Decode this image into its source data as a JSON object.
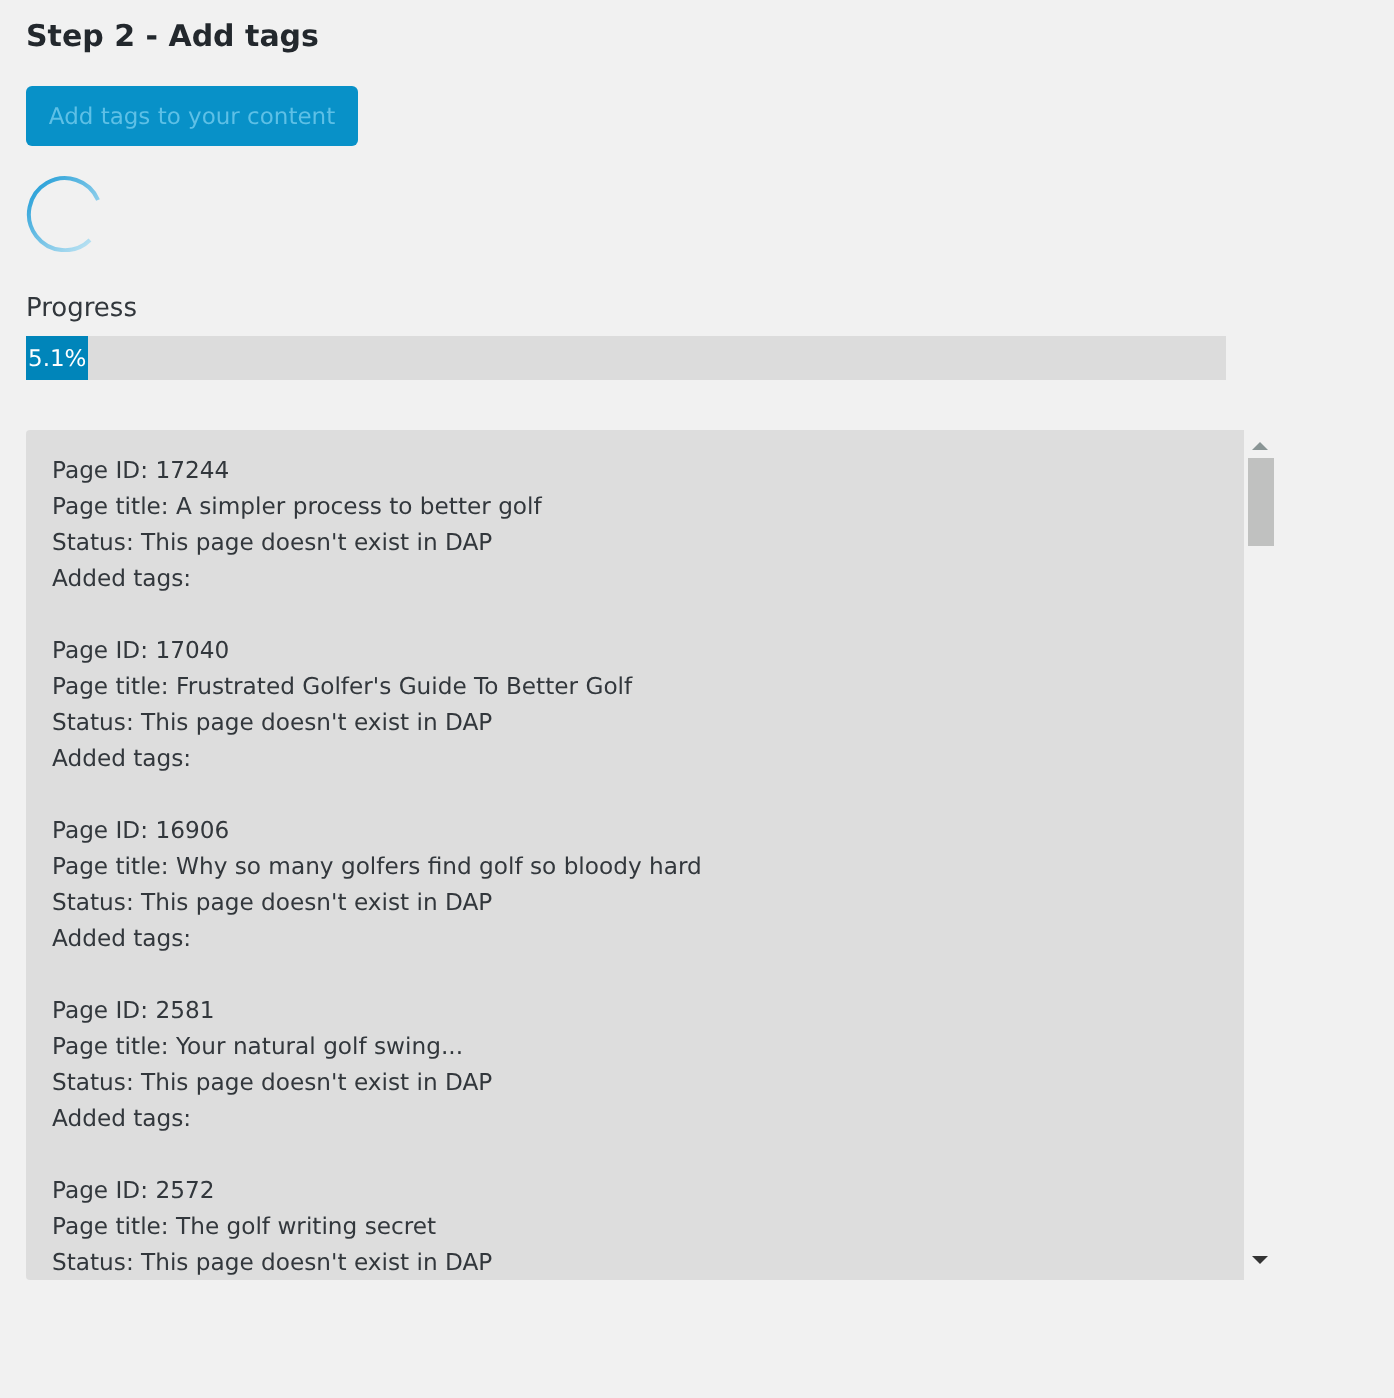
{
  "heading": "Step 2 - Add tags",
  "button": {
    "label": "Add tags to your content",
    "disabled": true
  },
  "loading": true,
  "progress": {
    "label": "Progress",
    "level": 0.051,
    "reading": "5.1%"
  },
  "log": [
    {
      "lines": [
        "Page ID: 17244",
        "Page title: A simpler process to better golf",
        "Status: This page doesn't exist in DAP",
        "Added tags:"
      ]
    },
    {
      "lines": [
        "Page ID: 17040",
        "Page title: Frustrated Golfer's Guide To Better Golf",
        "Status: This page doesn't exist in DAP",
        "Added tags:"
      ]
    },
    {
      "lines": [
        "Page ID: 16906",
        "Page title: Why so many golfers find golf so bloody hard",
        "Status: This page doesn't exist in DAP",
        "Added tags:"
      ]
    },
    {
      "lines": [
        "Page ID: 2581",
        "Page title: Your natural golf swing...",
        "Status: This page doesn't exist in DAP",
        "Added tags:"
      ]
    },
    {
      "lines": [
        "Page ID: 2572",
        "Page title: The golf writing secret",
        "Status: This page doesn't exist in DAP"
      ]
    }
  ]
}
